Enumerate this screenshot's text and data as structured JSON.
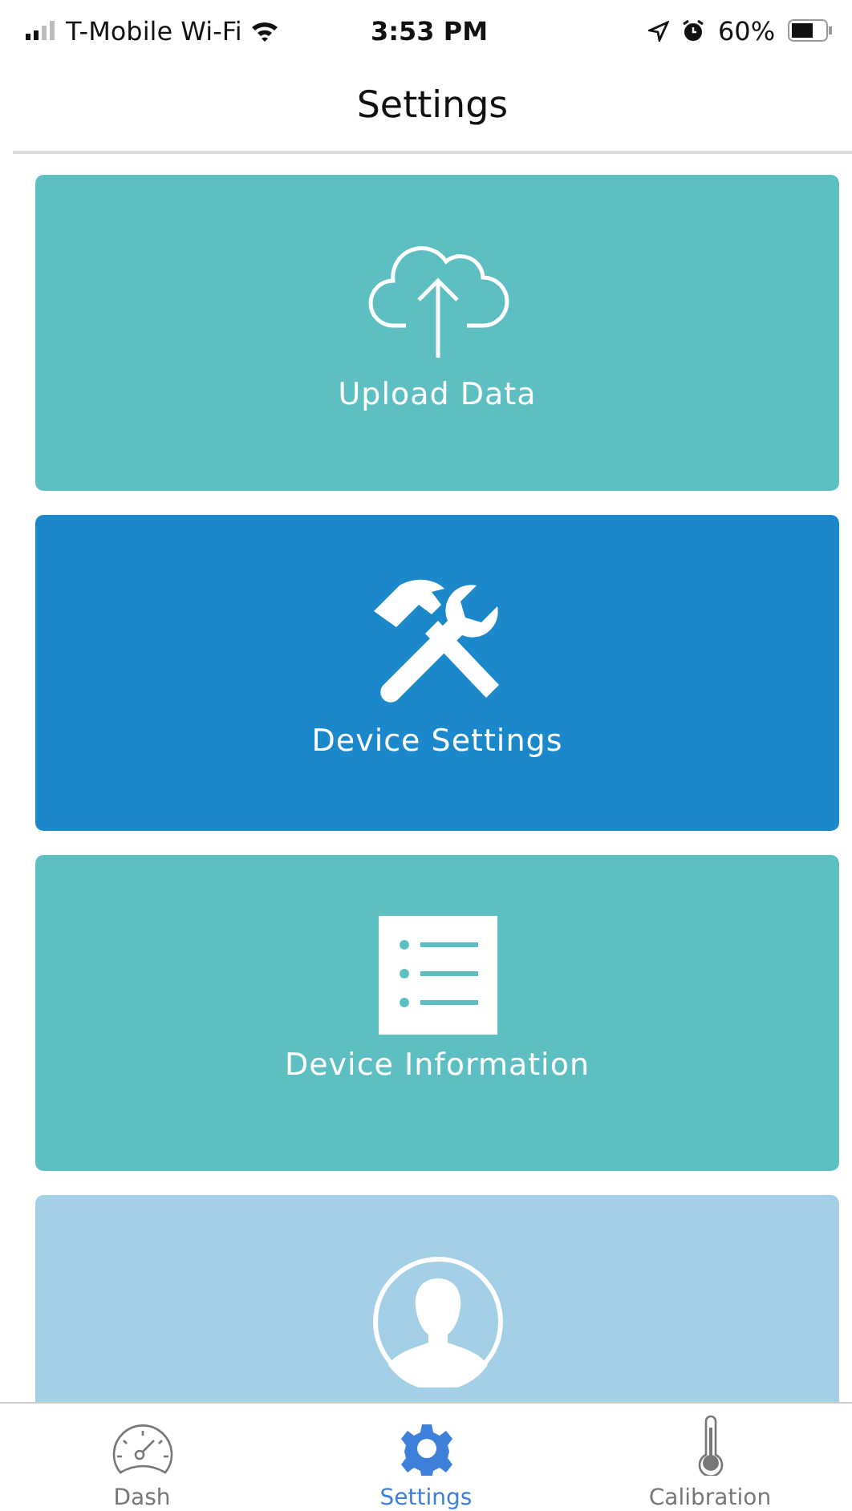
{
  "status_bar": {
    "carrier": "T-Mobile Wi-Fi",
    "time": "3:53 PM",
    "battery": "60%"
  },
  "header": {
    "title": "Settings"
  },
  "cards": [
    {
      "kind": "upload",
      "label": "Upload Data",
      "color": "#5ebfc2"
    },
    {
      "kind": "tools",
      "label": "Device Settings",
      "color": "#1b88cb"
    },
    {
      "kind": "info",
      "label": "Device Information",
      "color": "#5ebfc2"
    },
    {
      "kind": "profile",
      "color": "#a3d0e6"
    }
  ],
  "tab_bar": [
    {
      "kind": "dash",
      "label": "Dash",
      "selected": false
    },
    {
      "kind": "settings",
      "label": "Settings",
      "selected": true
    },
    {
      "kind": "thermometer",
      "label": "Calibration",
      "selected": false
    }
  ]
}
